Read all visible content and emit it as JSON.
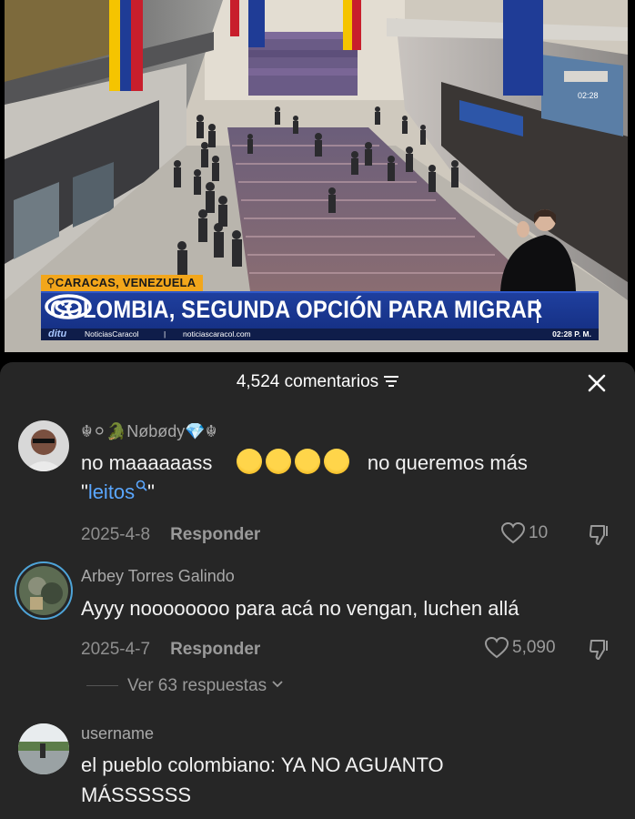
{
  "video": {
    "location": "CARACAS, VENEZUELA",
    "headline": "COLOMBIA, SEGUNDA OPCIÓN PARA MIGRAR",
    "ticker": {
      "brand": "ditu",
      "channel": "NoticiasCaracol",
      "separator": "|",
      "site": "noticiascaracol.com",
      "time": "02:28 P. M."
    },
    "board_time": "02:28",
    "logo_icon": "caracol-logo"
  },
  "comments_header": {
    "count_label": "4,524 comentarios",
    "filter_icon": "filter-icon",
    "close_icon": "close-icon"
  },
  "comments": [
    {
      "username": "☬⚪🐊Nøbødy💎☬",
      "text_before": "no maaaaaass",
      "emoji_count": 4,
      "emoji_name": "loudly-crying-face",
      "text_after": "no queremos más",
      "line2_prefix": "\"",
      "search_word": "leitos",
      "line2_suffix": "\"",
      "date": "2025-4-8",
      "reply_label": "Responder",
      "likes": "10"
    },
    {
      "username": "Arbey Torres Galindo",
      "text": "Ayyy noooooooo para acá no vengan, luchen allá",
      "date": "2025-4-7",
      "reply_label": "Responder",
      "likes": "5,090",
      "view_replies": "Ver 63 respuestas"
    },
    {
      "username": "username",
      "text_line1": "el pueblo colombiano: YA NO AGUANTO",
      "text_line2": "MÁSSSSSS"
    }
  ],
  "colors": {
    "sheet_bg": "#262626",
    "link_blue": "#5aa7ff",
    "headline_blue": "#1f3f9e",
    "location_orange": "#f2a61b"
  }
}
